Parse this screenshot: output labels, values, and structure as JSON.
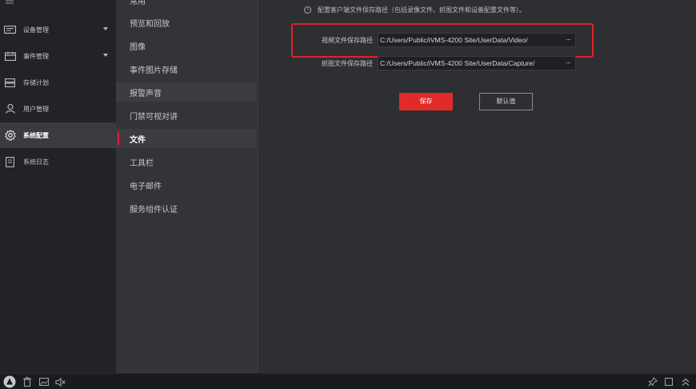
{
  "sidebar": {
    "items": [
      {
        "label": "设备管理",
        "icon": "device-icon",
        "has_caret": true
      },
      {
        "label": "事件管理",
        "icon": "event-icon",
        "has_caret": true
      },
      {
        "label": "存储计划",
        "icon": "storage-icon",
        "has_caret": false
      },
      {
        "label": "用户管理",
        "icon": "user-icon",
        "has_caret": false
      },
      {
        "label": "系统配置",
        "icon": "gear-icon",
        "has_caret": false,
        "active": true
      },
      {
        "label": "系统日志",
        "icon": "log-icon",
        "has_caret": false
      }
    ]
  },
  "subnav": {
    "items": [
      {
        "label": "常用"
      },
      {
        "label": "预览和回放"
      },
      {
        "label": "图像"
      },
      {
        "label": "事件图片存储"
      },
      {
        "label": "报警声音"
      },
      {
        "label": "门禁可视对讲"
      },
      {
        "label": "文件",
        "active": true
      },
      {
        "label": "工具栏"
      },
      {
        "label": "电子邮件"
      },
      {
        "label": "服务组件认证"
      }
    ]
  },
  "main": {
    "hint": "配置客户端文件保存路径（包括录像文件、抓图文件和设备配置文件等）。",
    "video_path": {
      "label": "视频文件保存路径",
      "value": "C:/Users/Public/iVMS-4200 Site/UserData/Video/",
      "browse": "···"
    },
    "capture_path": {
      "label": "抓图文件保存路径",
      "value": "C:/Users/Public/iVMS-4200 Site/UserData/Capture/",
      "browse": "···"
    },
    "save_label": "保存",
    "default_label": "默认值"
  },
  "colors": {
    "accent": "#e12b2b",
    "highlight_frame": "#e0232a",
    "background": "#2e2f33"
  }
}
